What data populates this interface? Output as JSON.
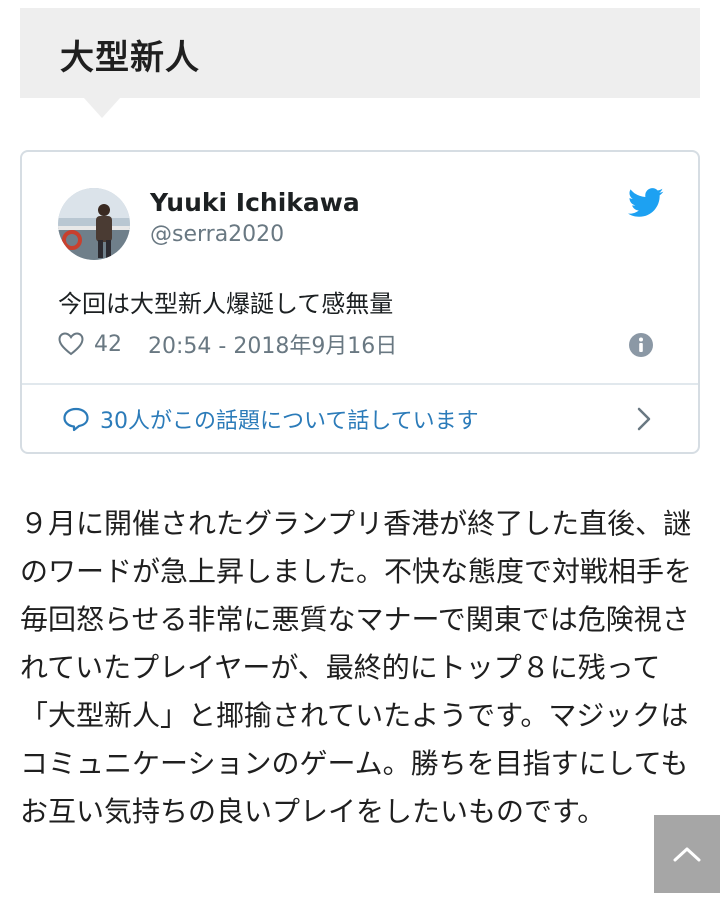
{
  "heading": {
    "title": "大型新人"
  },
  "tweet": {
    "user_name": "Yuuki Ichikawa",
    "user_handle": "@serra2020",
    "text": "今回は大型新人爆誕して感無量",
    "likes": "42",
    "timestamp": "20:54 - 2018年9月16日",
    "conversation": "30人がこの話題について話しています",
    "accent_color": "#1da1f2",
    "link_color": "#2b7bb9"
  },
  "article": {
    "body": "９月に開催されたグランプリ香港が終了した直後、謎のワードが急上昇しました。不快な態度で対戦相手を毎回怒らせる非常に悪質なマナーで関東では危険視されていたプレイヤーが、最終的にトップ８に残って「大型新人」と揶揄されていたようです。マジックはコミュニケーションのゲーム。勝ちを目指すにしてもお互い気持ちの良いプレイをしたいものです。"
  },
  "icons": {
    "twitter": "twitter-bird-icon",
    "like": "heart-icon",
    "info": "info-icon",
    "conversation": "speech-bubble-icon",
    "chevron": "chevron-right-icon",
    "scroll_top": "chevron-up-icon"
  }
}
